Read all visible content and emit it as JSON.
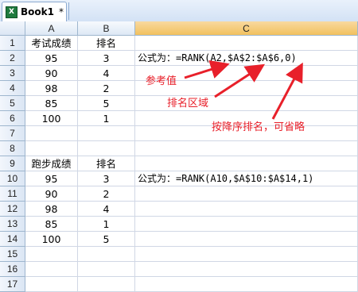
{
  "tab": {
    "name": "Book1",
    "modified": "*"
  },
  "columns": [
    "A",
    "B",
    "C"
  ],
  "rows": [
    "1",
    "2",
    "3",
    "4",
    "5",
    "6",
    "7",
    "8",
    "9",
    "10",
    "11",
    "12",
    "13",
    "14",
    "15",
    "16",
    "17"
  ],
  "cells": {
    "A1": "考试成绩",
    "B1": "排名",
    "A2": "95",
    "B2": "3",
    "C2": "公式为：=RANK(A2,$A$2:$A$6,0)",
    "A3": "90",
    "B3": "4",
    "A4": "98",
    "B4": "2",
    "A5": "85",
    "B5": "5",
    "A6": "100",
    "B6": "1",
    "A9": "跑步成绩",
    "B9": "排名",
    "A10": "95",
    "B10": "3",
    "C10": "公式为：=RANK(A10,$A$10:$A$14,1)",
    "A11": "90",
    "B11": "2",
    "A12": "98",
    "B12": "4",
    "A13": "85",
    "B13": "1",
    "A14": "100",
    "B14": "5"
  },
  "annotations": {
    "ref": "参考值",
    "range": "排名区域",
    "order": "按降序排名，可省略"
  },
  "colors": {
    "annotation": "#e8202a",
    "selected_header": "#f1c15f"
  }
}
